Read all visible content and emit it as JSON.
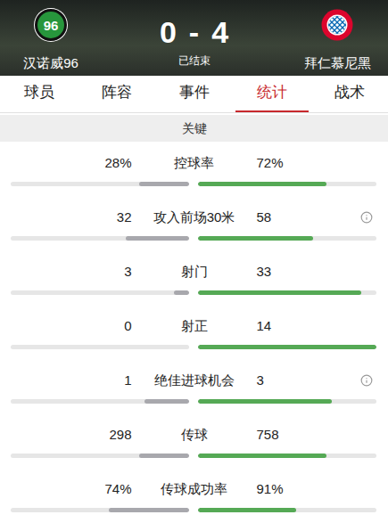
{
  "match": {
    "status": "已结束",
    "score": {
      "home": "0",
      "separator": "-",
      "away": "4"
    },
    "home": {
      "name": "汉诺威96",
      "logo_text": "96"
    },
    "away": {
      "name": "拜仁慕尼黑"
    }
  },
  "tabs": [
    {
      "label": "球员",
      "selected": false
    },
    {
      "label": "阵容",
      "selected": false
    },
    {
      "label": "事件",
      "selected": false
    },
    {
      "label": "统计",
      "selected": true
    },
    {
      "label": "战术",
      "selected": false
    }
  ],
  "section": {
    "title": "关键"
  },
  "stats": [
    {
      "label": "控球率",
      "home": "28%",
      "away": "72%",
      "home_level": 0.28,
      "away_level": 0.72,
      "info": false
    },
    {
      "label": "攻入前场30米",
      "home": "32",
      "away": "58",
      "home_level": 0.355,
      "away_level": 0.645,
      "info": true
    },
    {
      "label": "射门",
      "home": "3",
      "away": "33",
      "home_level": 0.083,
      "away_level": 0.917,
      "info": false
    },
    {
      "label": "射正",
      "home": "0",
      "away": "14",
      "home_level": 0,
      "away_level": 1,
      "info": false
    },
    {
      "label": "绝佳进球机会",
      "home": "1",
      "away": "3",
      "home_level": 0.25,
      "away_level": 0.75,
      "info": true
    },
    {
      "label": "传球",
      "home": "298",
      "away": "758",
      "home_level": 0.28,
      "away_level": 0.72,
      "info": false
    },
    {
      "label": "传球成功率",
      "home": "74%",
      "away": "91%",
      "home_level": 0.45,
      "away_level": 0.55,
      "info": false
    }
  ]
}
